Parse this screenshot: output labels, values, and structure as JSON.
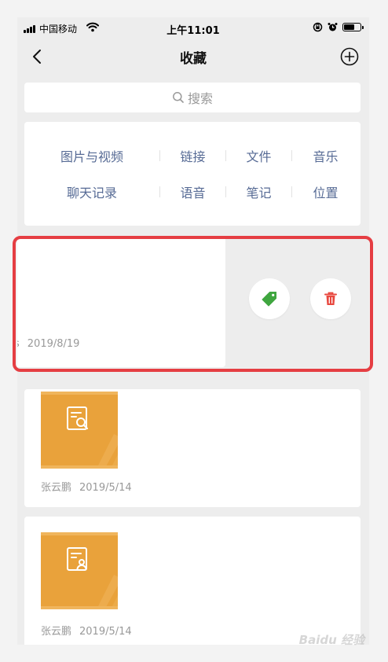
{
  "status_bar": {
    "carrier": "中国移动",
    "time": "上午11:01",
    "battery_level": 0.7
  },
  "nav": {
    "title": "收藏",
    "back_icon": "chevron-left-icon",
    "add_icon": "plus-circle-icon"
  },
  "search": {
    "placeholder": "搜索",
    "icon": "search-icon"
  },
  "categories": {
    "row1": [
      "图片与视频",
      "链接",
      "文件",
      "音乐"
    ],
    "row2": [
      "聊天记录",
      "语音",
      "笔记",
      "位置"
    ]
  },
  "swiped_item": {
    "meta_prefix": "s",
    "date": "2019/8/19",
    "actions": {
      "tag_icon": "tag-icon",
      "tag_color": "#3fa63f",
      "delete_icon": "trash-icon",
      "delete_color": "#e8473e"
    }
  },
  "items": [
    {
      "author": "张云鹏",
      "date": "2019/5/14",
      "thumb_icon": "document-search-icon"
    },
    {
      "author": "张云鹏",
      "date": "2019/5/14",
      "thumb_icon": "document-user-icon"
    }
  ],
  "colors": {
    "link_blue": "#576b95",
    "highlight_red": "#e53e43",
    "thumb_orange": "#e9a23b"
  },
  "watermark": "Baidu 经验"
}
